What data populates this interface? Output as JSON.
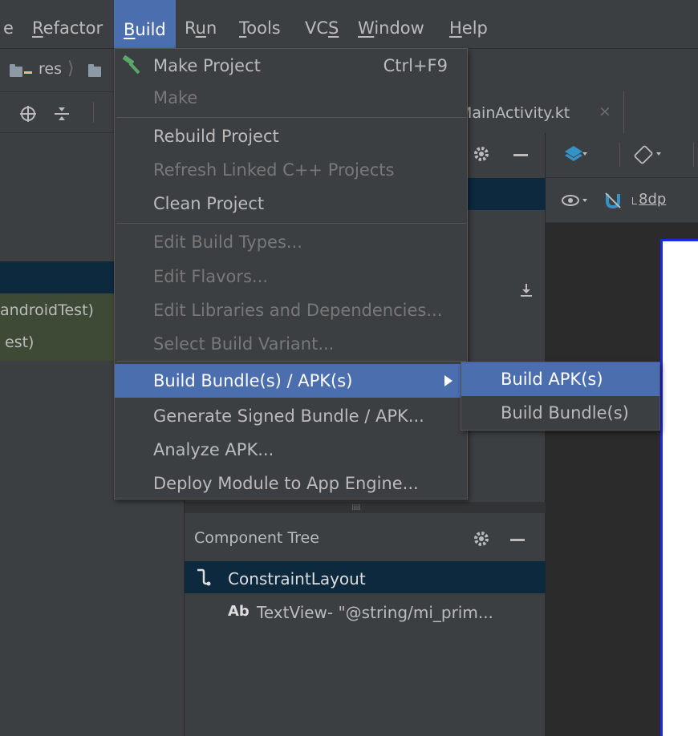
{
  "menubar": {
    "items": [
      {
        "label": "e",
        "mnemonic": ""
      },
      {
        "label": "Refactor",
        "mnemonic": "R"
      },
      {
        "label": "Build",
        "mnemonic": "B"
      },
      {
        "label": "Run",
        "mnemonic": "u"
      },
      {
        "label": "Tools",
        "mnemonic": "T"
      },
      {
        "label": "VCS",
        "mnemonic": "S"
      },
      {
        "label": "Window",
        "mnemonic": "W"
      },
      {
        "label": "Help",
        "mnemonic": "H"
      }
    ],
    "active": "Build"
  },
  "breadcrumb": {
    "items": [
      "res"
    ]
  },
  "editor_tab": {
    "label": "MainActivity.kt"
  },
  "left_panel": {
    "row1": "androidTest)",
    "row2": "est)"
  },
  "design_toolbar": {
    "dp_value": "8dp"
  },
  "build_menu": {
    "items": [
      {
        "label": "Make Project",
        "shortcut": "Ctrl+F9",
        "disabled": false
      },
      {
        "label": "Make",
        "disabled": true
      },
      {
        "label": "Rebuild Project",
        "disabled": false
      },
      {
        "label": "Refresh Linked C++ Projects",
        "disabled": true
      },
      {
        "label": "Clean Project",
        "disabled": false
      },
      {
        "label": "Edit Build Types...",
        "disabled": true
      },
      {
        "label": "Edit Flavors...",
        "disabled": true
      },
      {
        "label": "Edit Libraries and Dependencies...",
        "disabled": true
      },
      {
        "label": "Select Build Variant...",
        "disabled": true
      },
      {
        "label": "Build Bundle(s) / APK(s)",
        "disabled": false,
        "highlighted": true
      },
      {
        "label": "Generate Signed Bundle / APK...",
        "disabled": false
      },
      {
        "label": "Analyze APK...",
        "disabled": false
      },
      {
        "label": "Deploy Module to App Engine...",
        "disabled": false
      }
    ]
  },
  "submenu": {
    "items": [
      {
        "label": "Build APK(s)",
        "highlighted": true
      },
      {
        "label": "Build Bundle(s)",
        "highlighted": false
      }
    ]
  },
  "component_tree": {
    "title": "Component Tree",
    "root": "ConstraintLayout",
    "child_prefix": "Ab",
    "child": "TextView- \"@string/mi_prim..."
  },
  "colors": {
    "menu_bg": "#3c3f41",
    "highlight": "#4b6eaf",
    "disabled_text": "#787878",
    "selection_row": "#0d293e"
  }
}
